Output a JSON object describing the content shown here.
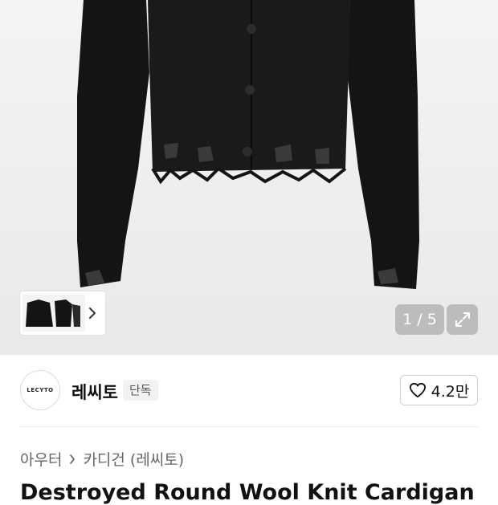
{
  "gallery": {
    "current_page": "1",
    "total_pages": "5",
    "pager_label": "1 / 5",
    "image_desc_icon": "cardigan-photo",
    "thumbnail_icon": "thumbnail-image",
    "next_icon": "chevron-right-icon",
    "expand_icon": "expand-icon"
  },
  "brand": {
    "logo_text": "LECYTO",
    "name": "레씨토",
    "badge": "단독",
    "like_icon": "heart-icon",
    "like_count": "4.2만"
  },
  "breadcrumb": {
    "category": "아우터",
    "subcategory": "카디건 (레씨토)"
  },
  "product": {
    "title": "Destroyed Round Wool Knit Cardigan [Blac"
  },
  "colors": {
    "hero_bg": "#efefef",
    "garment": "#141414",
    "overlay": "#969696"
  }
}
